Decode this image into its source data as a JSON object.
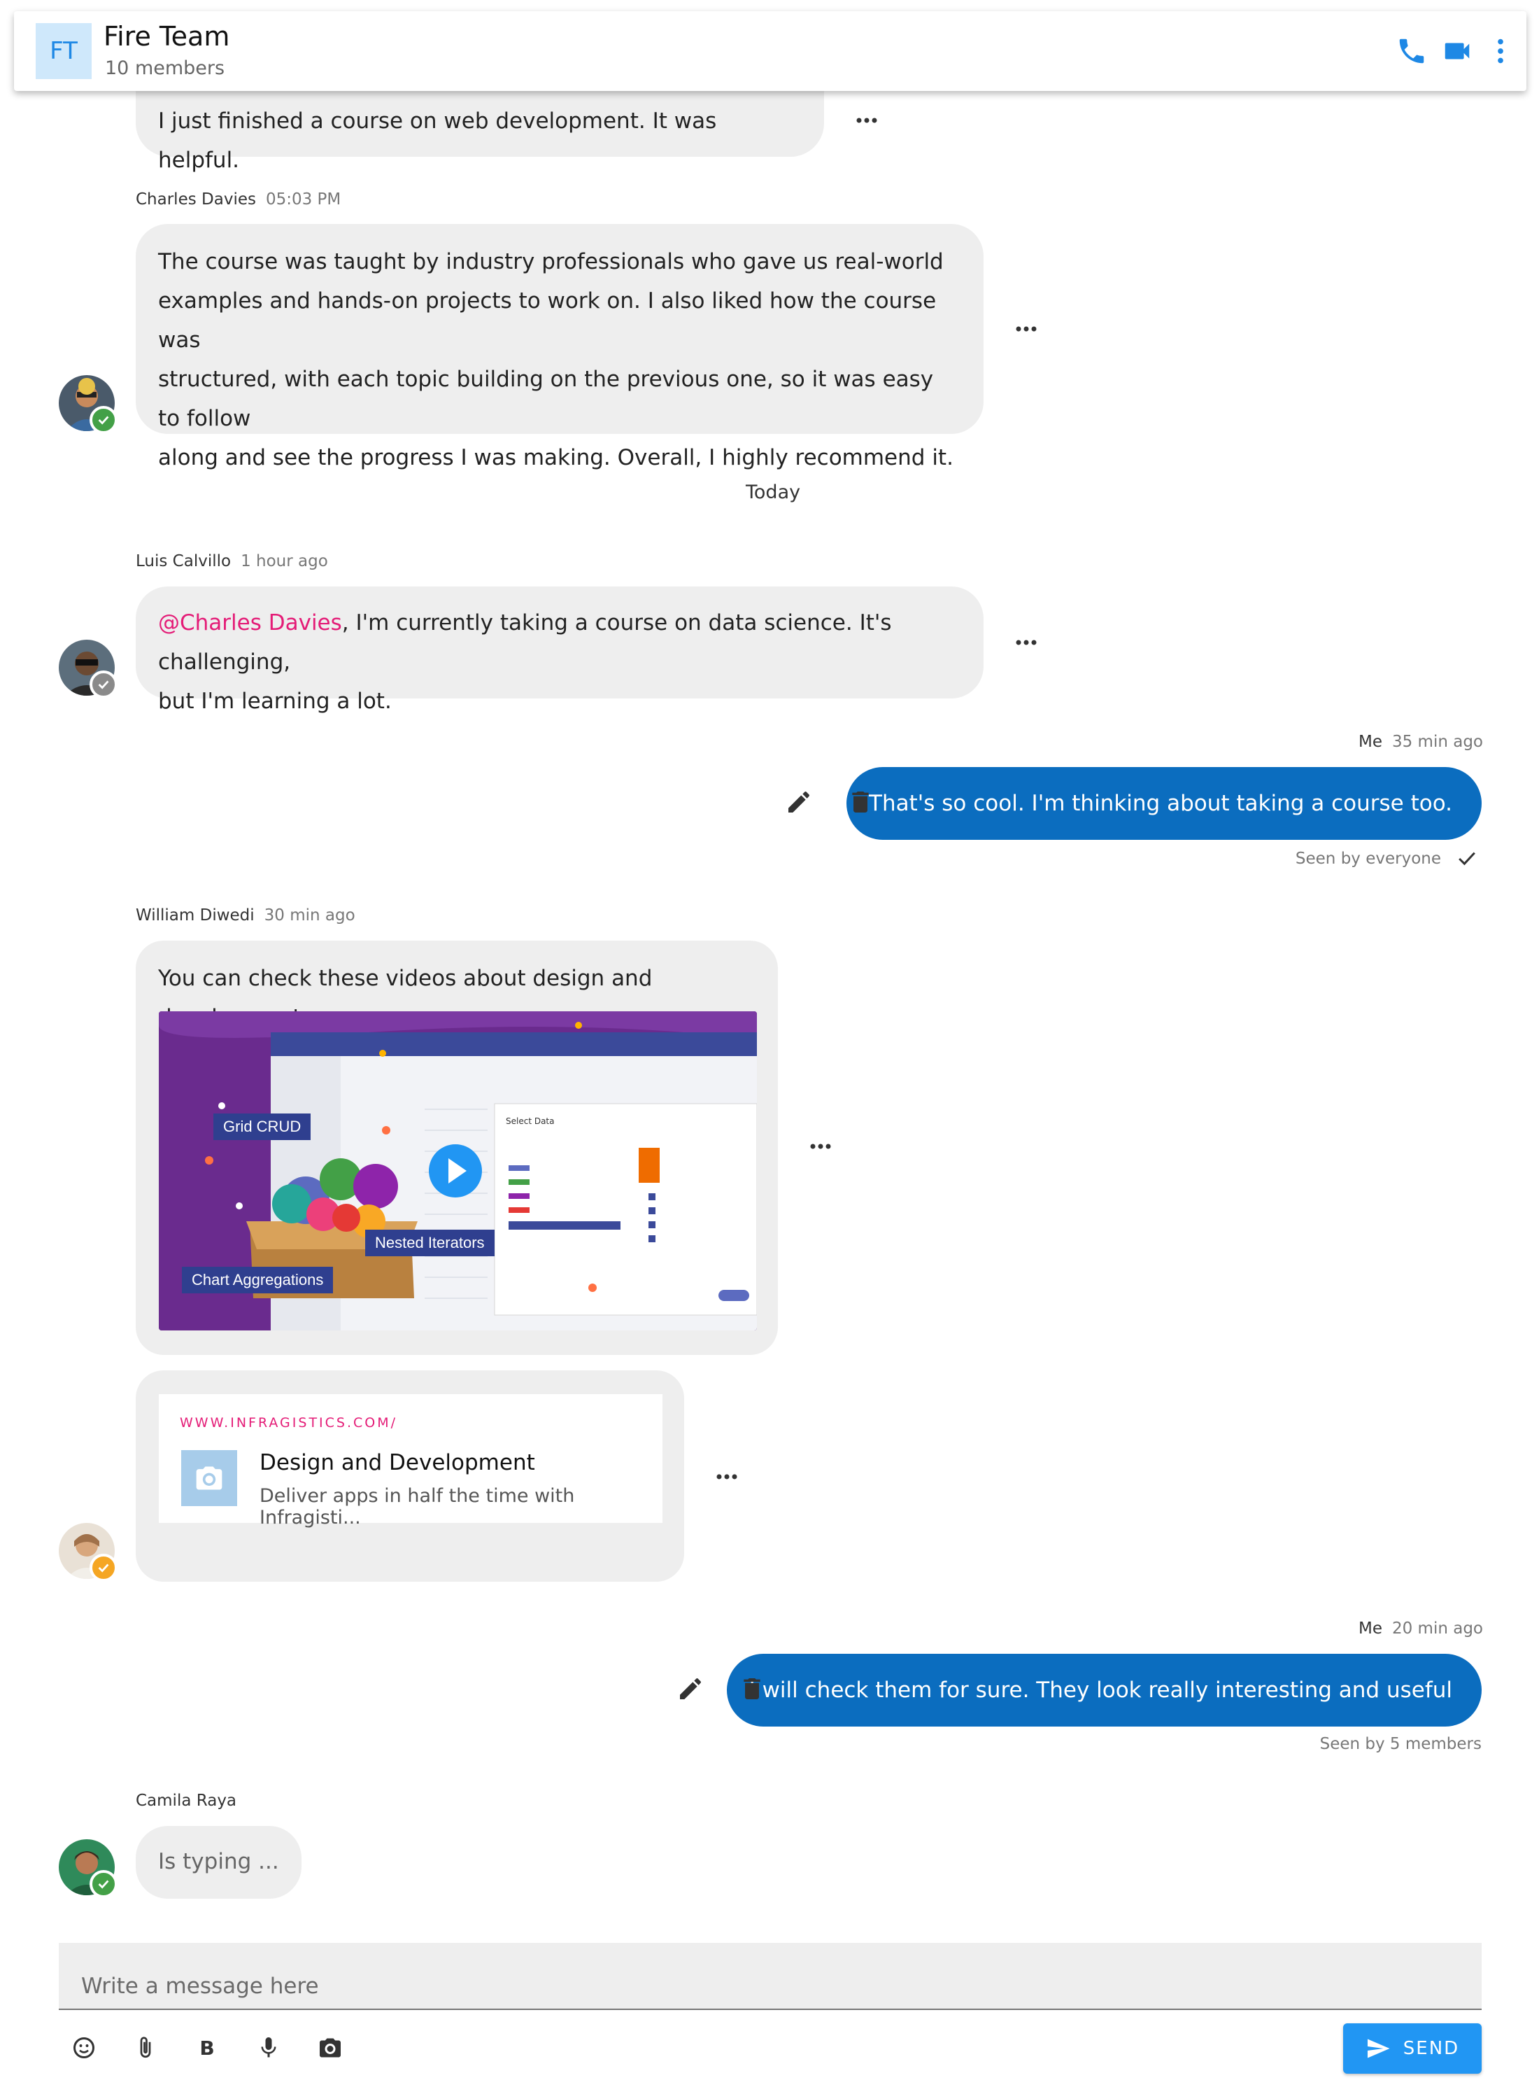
{
  "header": {
    "initials": "FT",
    "title": "Fire Team",
    "members": "10 members",
    "icons": [
      "phone-icon",
      "video-icon",
      "more-vert-icon"
    ]
  },
  "messages": {
    "m0": {
      "text": "I just finished a course on web development. It was helpful."
    },
    "m1": {
      "sender": "Charles Davies",
      "time": "05:03 PM",
      "lines": [
        "The course was taught by industry professionals who gave us real-world",
        "examples and hands-on projects to work on. I also liked how the course was",
        "structured, with each topic building on the previous one, so it was easy to follow",
        "along and see the progress I was making. Overall, I highly recommend it."
      ]
    },
    "divider": "Today",
    "m2": {
      "sender": "Luis Calvillo",
      "time": "1 hour ago",
      "mention": "@Charles Davies",
      "line1_rest": ", I'm currently taking a course on data science. It's challenging,",
      "line2": "but I'm learning a lot."
    },
    "m3": {
      "sender": "Me",
      "time": "35 min ago",
      "text": "That's so cool. I'm thinking about taking a course too.",
      "seen": "Seen by everyone"
    },
    "m4": {
      "sender": "William Diwedi",
      "time": "30 min ago",
      "text": "You can check these videos about design and development.",
      "thumb_labels": {
        "grid": "Grid CRUD",
        "nested": "Nested Iterators",
        "chart": "Chart Aggregations",
        "dialog": "Select Data"
      },
      "link": {
        "url": "WWW.INFRAGISTICS.COM/",
        "title": "Design and Development",
        "desc": "Deliver apps in half the time with Infragisti..."
      }
    },
    "m5": {
      "sender": "Me",
      "time": "20 min ago",
      "text": "I will check them for sure. They look really interesting and useful",
      "seen": "Seen by 5 members"
    },
    "m6": {
      "sender": "Camila Raya",
      "text": "Is typing ..."
    }
  },
  "status_colors": {
    "online": "#43a047",
    "offline": "#8a8a8a",
    "away": "#f5a623"
  },
  "composer": {
    "placeholder": "Write a message here",
    "tools": [
      "emoji-icon",
      "attach-icon",
      "bold-icon",
      "mic-icon",
      "camera-icon"
    ],
    "send_label": "SEND"
  },
  "colors": {
    "accent": "#2196f3",
    "me_bubble": "#0b6dbf",
    "mention": "#e41c77"
  }
}
